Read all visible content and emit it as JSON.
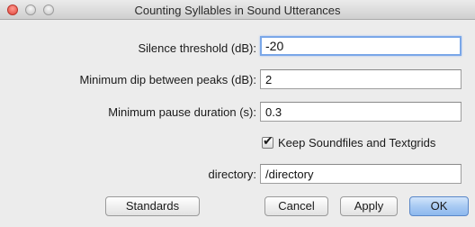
{
  "window": {
    "title": "Counting Syllables in Sound Utterances"
  },
  "form": {
    "silence_threshold": {
      "label": "Silence threshold (dB):",
      "value": "-20"
    },
    "minimum_dip": {
      "label": "Minimum dip between peaks (dB):",
      "value": "2"
    },
    "minimum_pause": {
      "label": "Minimum pause duration (s):",
      "value": "0.3"
    },
    "keep_files": {
      "label": "Keep Soundfiles and Textgrids",
      "checked": true,
      "check_glyph": "✔"
    },
    "directory": {
      "label": "directory:",
      "value": "/directory"
    }
  },
  "buttons": {
    "standards": "Standards",
    "cancel": "Cancel",
    "apply": "Apply",
    "ok": "OK"
  },
  "colors": {
    "default_button": "#a9cbf3",
    "focus_ring": "#7aa7e8",
    "close_button": "#e0443a"
  }
}
